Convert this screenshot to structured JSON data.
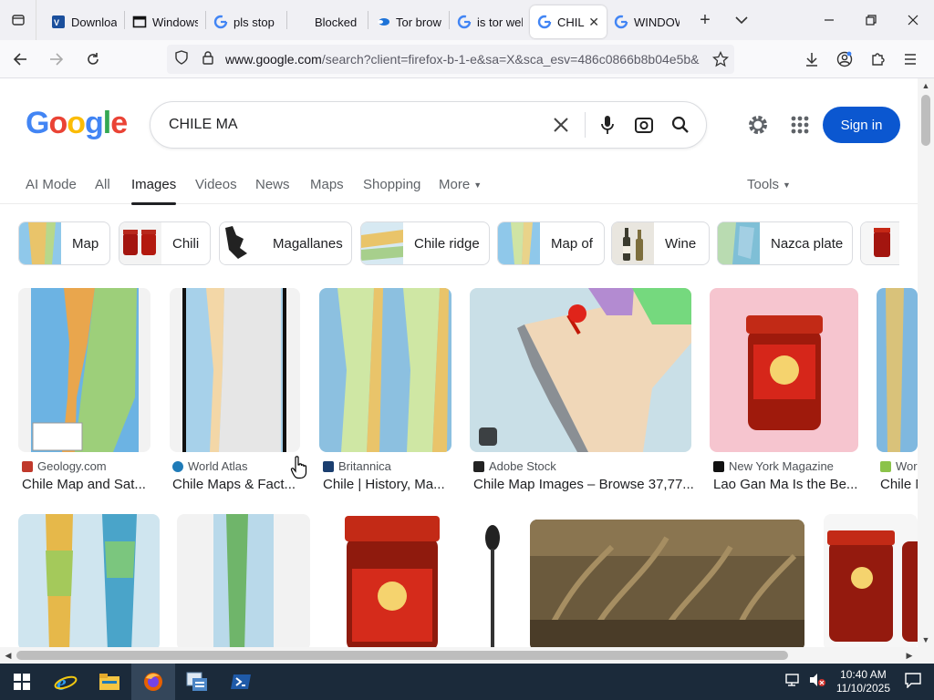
{
  "browser": {
    "tabs": [
      {
        "title": "Downloa",
        "favicon": "vb-icon"
      },
      {
        "title": "Windows",
        "favicon": "window-icon"
      },
      {
        "title": "pls stop",
        "favicon": "google-g-icon"
      },
      {
        "title": "Blocked",
        "favicon": "blank"
      },
      {
        "title": "Tor brow",
        "favicon": "tor-icon"
      },
      {
        "title": "is tor wel",
        "favicon": "google-g-icon"
      },
      {
        "title": "CHILE",
        "favicon": "google-g-icon",
        "active": true
      },
      {
        "title": "WINDOW",
        "favicon": "google-g-icon"
      }
    ],
    "url_domain": "www.google.com",
    "url_rest": "/search?client=firefox-b-1-e&sa=X&sca_esv=486c0866b8b04e5b&ch"
  },
  "google": {
    "query": "CHILE MA",
    "signin_label": "Sign in",
    "nav_tabs": [
      "AI Mode",
      "All",
      "Images",
      "Videos",
      "News",
      "Maps",
      "Shopping",
      "More"
    ],
    "active_tab": "Images",
    "tools_label": "Tools",
    "chips": [
      "Map",
      "Chili",
      "Magallanes",
      "Chile ridge",
      "Map of",
      "Wine",
      "Nazca plate"
    ],
    "results_row1": [
      {
        "source": "Geology.com",
        "caption": "Chile Map and Sat..."
      },
      {
        "source": "World Atlas",
        "caption": "Chile Maps & Fact..."
      },
      {
        "source": "Britannica",
        "caption": "Chile | History, Ma..."
      },
      {
        "source": "Adobe Stock",
        "caption": "Chile Map Images – Browse 37,77..."
      },
      {
        "source": "New York Magazine",
        "caption": "Lao Gan Ma Is the Be..."
      },
      {
        "source": "Worl",
        "caption": "Chile M"
      }
    ]
  },
  "taskbar": {
    "time": "10:40 AM",
    "date": "11/10/2025"
  },
  "colors": {
    "google_blue": "#4285f4",
    "google_red": "#ea4335",
    "google_yellow": "#fbbc05",
    "google_green": "#34a853",
    "signin_bg": "#0b57d0"
  }
}
